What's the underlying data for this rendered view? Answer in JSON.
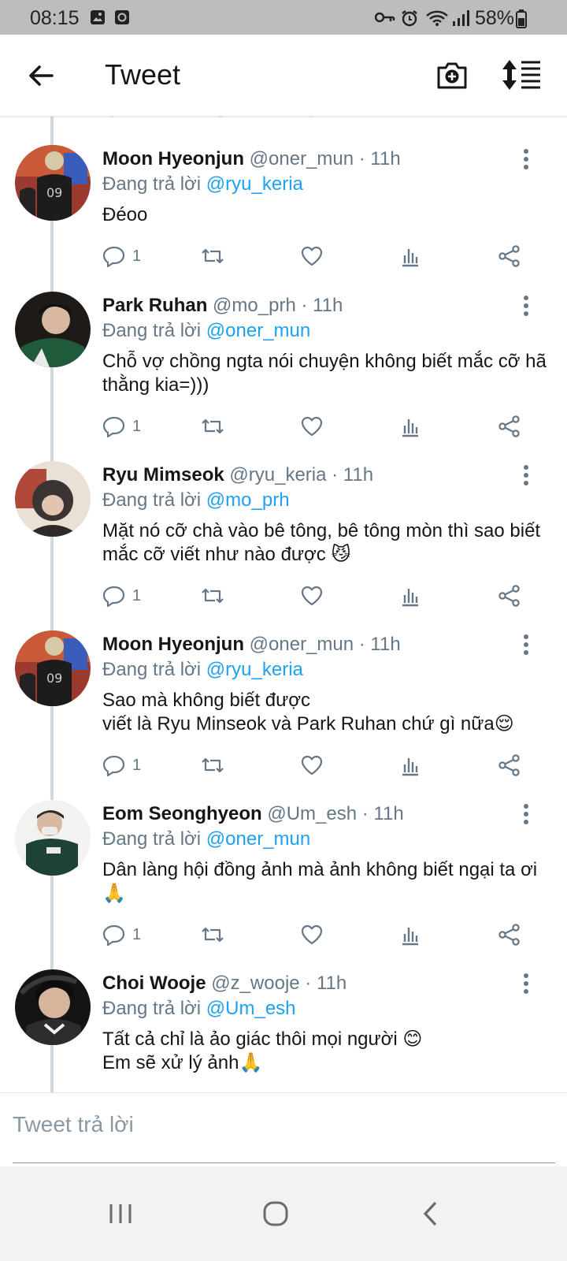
{
  "status_bar": {
    "time": "08:15",
    "battery": "58%"
  },
  "header": {
    "title": "Tweet"
  },
  "tweets": [
    {
      "name": "Moon Hyeonjun",
      "meta": "@oner_mun · 11h",
      "reply_prefix": "Đang trả lời",
      "reply_to": "@ryu_keria",
      "body": "Đéoo",
      "reply_count": "1"
    },
    {
      "name": "Park Ruhan",
      "meta": "@mo_prh · 11h",
      "reply_prefix": "Đang trả lời",
      "reply_to": "@oner_mun",
      "body": "Chỗ vợ chồng ngta nói chuyện không biết mắc cỡ hã thằng kia=)))",
      "reply_count": "1"
    },
    {
      "name": "Ryu Mimseok",
      "meta": "@ryu_keria · 11h",
      "reply_prefix": "Đang trả lời",
      "reply_to": "@mo_prh",
      "body": "Mặt nó cỡ chà vào bê tông, bê tông mòn thì sao biết mắc cỡ viết như nào được 😼",
      "reply_count": "1"
    },
    {
      "name": "Moon Hyeonjun",
      "meta": "@oner_mun · 11h",
      "reply_prefix": "Đang trả lời",
      "reply_to": "@ryu_keria",
      "body": "Sao mà không biết được\nviết là Ryu Minseok và Park Ruhan chứ gì nữa😌",
      "reply_count": "1"
    },
    {
      "name": "Eom Seonghyeon",
      "meta": "@Um_esh · 11h",
      "reply_prefix": "Đang trả lời",
      "reply_to": "@oner_mun",
      "body": "Dân làng hội đồng ảnh mà ảnh không biết ngại ta ơi🙏",
      "reply_count": "1"
    },
    {
      "name": "Choi Wooje",
      "meta": "@z_wooje · 11h",
      "reply_prefix": "Đang trả lời",
      "reply_to": "@Um_esh",
      "body": "Tất cả chỉ là ảo giác thôi mọi người 😊\n Em sẽ xử lý ảnh🙏"
    }
  ],
  "composer": {
    "placeholder": "Tweet trả lời"
  },
  "icons": {
    "back": "arrow-left-icon",
    "camera": "camera-add-icon",
    "sort": "sort-icon",
    "reply": "reply-icon",
    "retweet": "retweet-icon",
    "like": "heart-icon",
    "stats": "analytics-icon",
    "share": "share-icon",
    "more": "more-vertical-icon"
  },
  "colors": {
    "accent": "#1da1f2",
    "muted": "#657786",
    "text": "#14171a"
  }
}
